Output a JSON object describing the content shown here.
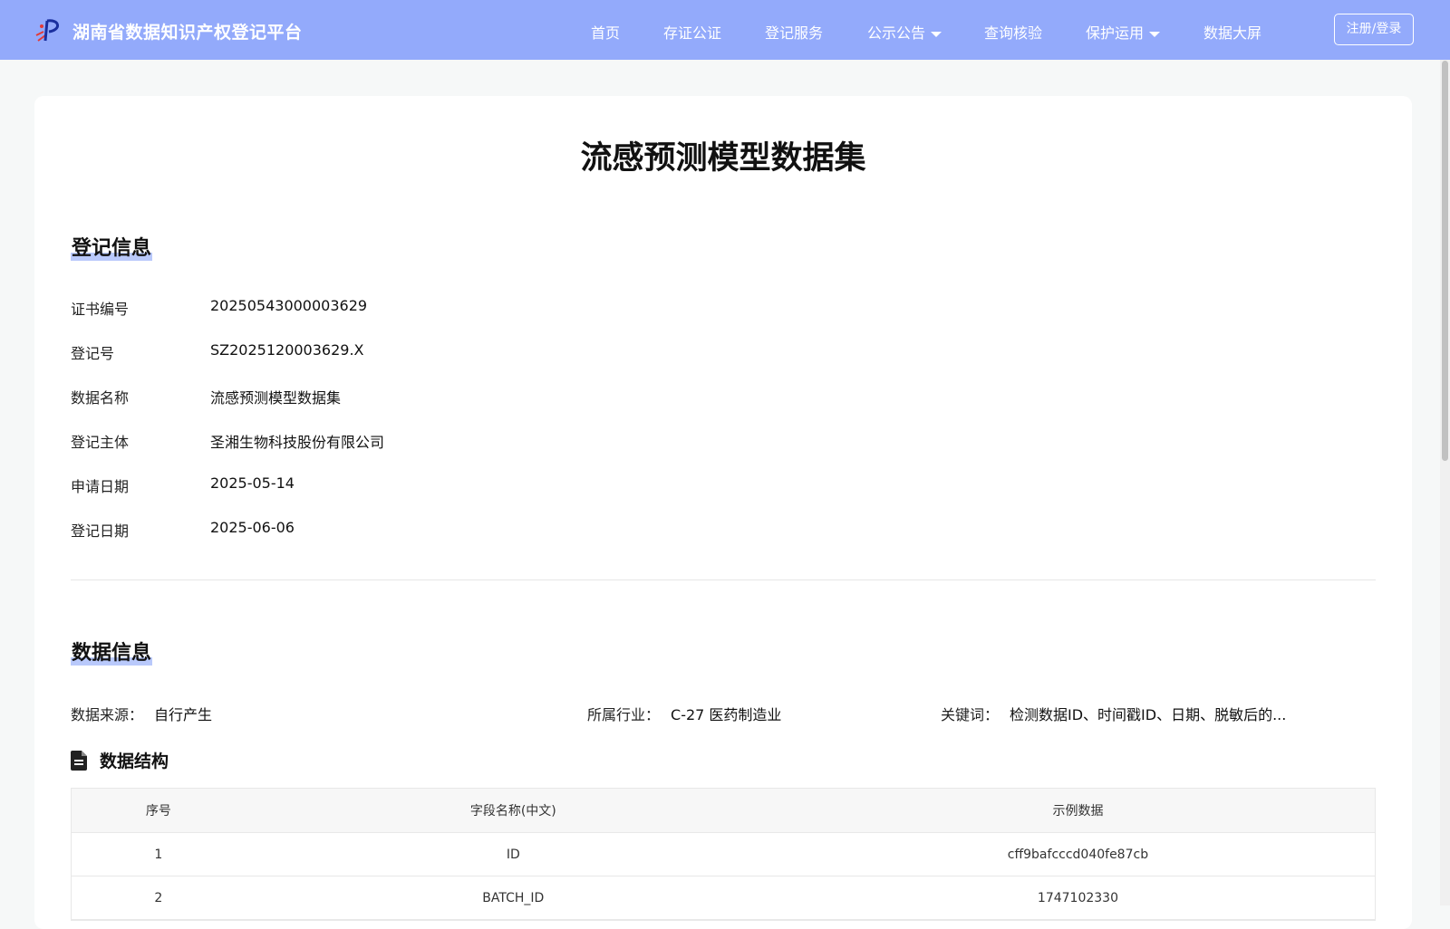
{
  "header": {
    "brand": "湖南省数据知识产权登记平台",
    "nav": {
      "home": "首页",
      "notary": "存证公证",
      "register": "登记服务",
      "announce": "公示公告",
      "query": "查询核验",
      "protect": "保护运用",
      "dashboard": "数据大屏"
    },
    "login": "注册/登录"
  },
  "page_title": "流感预测模型数据集",
  "registration": {
    "section_title": "登记信息",
    "rows": [
      {
        "label": "证书编号",
        "value": "20250543000003629"
      },
      {
        "label": "登记号",
        "value": "SZ2025120003629.X"
      },
      {
        "label": "数据名称",
        "value": "流感预测模型数据集"
      },
      {
        "label": "登记主体",
        "value": "圣湘生物科技股份有限公司"
      },
      {
        "label": "申请日期",
        "value": "2025-05-14"
      },
      {
        "label": "登记日期",
        "value": "2025-06-06"
      }
    ]
  },
  "data_info": {
    "section_title": "数据信息",
    "source_label": "数据来源：",
    "source_value": "自行产生",
    "industry_label": "所属行业：",
    "industry_value": "C-27 医药制造业",
    "keywords_label": "关键词：",
    "keywords_value": "检测数据ID、时间戳ID、日期、脱敏后的..."
  },
  "structure": {
    "title": "数据结构",
    "columns": [
      "序号",
      "字段名称(中文)",
      "示例数据"
    ],
    "rows": [
      [
        "1",
        "ID",
        "cff9bafcccd040fe87cb"
      ],
      [
        "2",
        "BATCH_ID",
        "1747102330"
      ]
    ]
  }
}
